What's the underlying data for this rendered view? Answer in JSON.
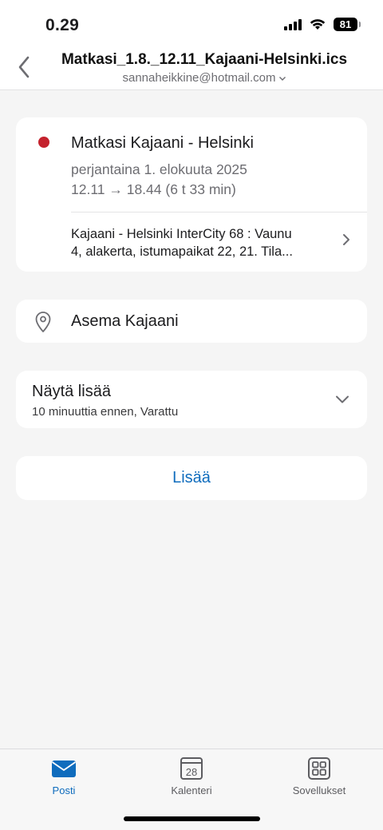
{
  "status_bar": {
    "time": "0.29",
    "battery": "81"
  },
  "header": {
    "title": "Matkasi_1.8._12.11_Kajaani-Helsinki.ics",
    "account": "sannaheikkine@hotmail.com"
  },
  "event": {
    "title": "Matkasi Kajaani - Helsinki",
    "date": "perjantaina 1. elokuuta 2025",
    "time": "12.11 → 18.44 (6 t 33 min)",
    "description_line1": "Kajaani - Helsinki InterCity 68 : Vaunu",
    "description_line2": "4, alakerta, istumapaikat 22, 21. Tila...",
    "calendar_color": "#c4222d"
  },
  "location": {
    "label": "Asema Kajaani"
  },
  "more": {
    "title": "Näytä lisää",
    "subtitle": "10 minuuttia ennen, Varattu"
  },
  "actions": {
    "add_label": "Lisää"
  },
  "tabs": [
    {
      "label": "Posti",
      "icon": "mail-icon",
      "active": true
    },
    {
      "label": "Kalenteri",
      "icon": "calendar-icon",
      "day": "28"
    },
    {
      "label": "Sovellukset",
      "icon": "apps-icon"
    }
  ],
  "colors": {
    "accent": "#0f6cbd",
    "background": "#f5f5f5"
  }
}
